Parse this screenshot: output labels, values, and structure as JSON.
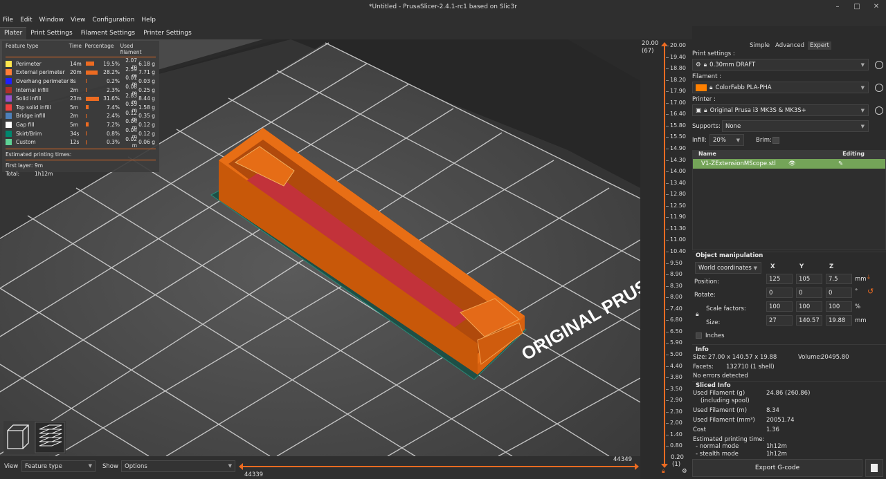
{
  "app": {
    "title": "*Untitled - PrusaSlicer-2.4.1-rc1 based on Slic3r"
  },
  "menu": [
    "File",
    "Edit",
    "Window",
    "View",
    "Configuration",
    "Help"
  ],
  "tabs": [
    "Plater",
    "Print Settings",
    "Filament Settings",
    "Printer Settings"
  ],
  "legend": {
    "headers": {
      "feature": "Feature type",
      "time": "Time",
      "pct": "Percentage",
      "filament": "Used filament"
    },
    "rows": [
      {
        "name": "Perimeter",
        "time": "14m",
        "pct": "19.5%",
        "m": "2.07 m",
        "g": "6.18 g",
        "color": "#ffe64d",
        "frac": 0.195
      },
      {
        "name": "External perimeter",
        "time": "20m",
        "pct": "28.2%",
        "m": "2.59 m",
        "g": "7.71 g",
        "color": "#ff7d38",
        "frac": 0.282
      },
      {
        "name": "Overhang perimeter",
        "time": "8s",
        "pct": "0.2%",
        "m": "0.01 m",
        "g": "0.03 g",
        "color": "#1f1fff",
        "frac": 0.002
      },
      {
        "name": "Internal infill",
        "time": "2m",
        "pct": "2.3%",
        "m": "0.08 m",
        "g": "0.25 g",
        "color": "#b03029",
        "frac": 0.023
      },
      {
        "name": "Solid infill",
        "time": "23m",
        "pct": "31.6%",
        "m": "2.83 m",
        "g": "8.44 g",
        "color": "#9654cc",
        "frac": 0.316
      },
      {
        "name": "Top solid infill",
        "time": "5m",
        "pct": "7.4%",
        "m": "0.53 m",
        "g": "1.58 g",
        "color": "#f04040",
        "frac": 0.074
      },
      {
        "name": "Bridge infill",
        "time": "2m",
        "pct": "2.4%",
        "m": "0.12 m",
        "g": "0.35 g",
        "color": "#4d80ba",
        "frac": 0.024
      },
      {
        "name": "Gap fill",
        "time": "5m",
        "pct": "7.2%",
        "m": "0.04 m",
        "g": "0.12 g",
        "color": "#ffffff",
        "frac": 0.072
      },
      {
        "name": "Skirt/Brim",
        "time": "34s",
        "pct": "0.8%",
        "m": "0.04 m",
        "g": "0.12 g",
        "color": "#00876e",
        "frac": 0.008
      },
      {
        "name": "Custom",
        "time": "12s",
        "pct": "0.3%",
        "m": "0.02 m",
        "g": "0.06 g",
        "color": "#5ed194",
        "frac": 0.003
      }
    ],
    "est_label": "Estimated printing times:",
    "first_layer_label": "First layer:",
    "first_layer": "9m",
    "total_label": "Total:",
    "total": "1h12m"
  },
  "bed_text": "ORIGINAL PRUSA",
  "bottom": {
    "view_label": "View",
    "view_value": "Feature type",
    "show_label": "Show",
    "show_value": "Options",
    "h_right": "44349",
    "h_left": "44339"
  },
  "vslider": {
    "top_value": "20.00",
    "top_layer": "(67)",
    "bottom_value": "0.20",
    "bottom_layer": "(1)",
    "ticks": [
      "20.00",
      "19.40",
      "18.80",
      "18.20",
      "17.90",
      "17.00",
      "16.40",
      "15.80",
      "15.50",
      "14.90",
      "14.30",
      "14.00",
      "13.40",
      "12.80",
      "12.50",
      "11.90",
      "11.30",
      "11.00",
      "10.40",
      "9.50",
      "8.90",
      "8.30",
      "8.00",
      "7.40",
      "6.80",
      "6.50",
      "5.90",
      "5.00",
      "4.40",
      "3.80",
      "3.50",
      "2.90",
      "2.30",
      "2.00",
      "1.40",
      "0.80",
      "0.20"
    ]
  },
  "panel": {
    "modes": [
      "Simple",
      "Advanced",
      "Expert"
    ],
    "print_settings_label": "Print settings :",
    "print_settings_value": "0.30mm DRAFT",
    "filament_label": "Filament :",
    "filament_value": "ColorFabb PLA-PHA",
    "filament_color": "#ff8000",
    "printer_label": "Printer :",
    "printer_value": "Original Prusa i3 MK3S & MK3S+",
    "supports_label": "Supports:",
    "supports_value": "None",
    "infill_label": "Infill:",
    "infill_value": "20%",
    "brim_label": "Brim:",
    "list_name_header": "Name",
    "list_editing_header": "Editing",
    "object_name": "V1-ZExtensionMScope.stl",
    "objman_title": "Object manipulation",
    "coord_system": "World coordinates",
    "axis_x": "X",
    "axis_y": "Y",
    "axis_z": "Z",
    "position_label": "Position:",
    "pos": [
      "125",
      "105",
      "7.5"
    ],
    "pos_unit": "mm",
    "rotate_label": "Rotate:",
    "rot": [
      "0",
      "0",
      "0"
    ],
    "rot_unit": "°",
    "scale_label": "Scale factors:",
    "scale": [
      "100",
      "100",
      "100"
    ],
    "scale_unit": "%",
    "size_label": "Size:",
    "size": [
      "27",
      "140.57",
      "19.88"
    ],
    "size_unit": "mm",
    "inches_label": "Inches",
    "info_title": "Info",
    "info_size_label": "Size:",
    "info_size": "27.00 x 140.57 x 19.88",
    "info_volume_label": "Volume:",
    "info_volume": "20495.80",
    "info_facets_label": "Facets:",
    "info_facets": "132710 (1 shell)",
    "info_errors": "No errors detected",
    "sliced_title": "Sliced Info",
    "used_g_label": "Used Filament (g)",
    "used_g_sub": "(including spool)",
    "used_g": "24.86 (260.86)",
    "used_m_label": "Used Filament (m)",
    "used_m": "8.34",
    "used_mm3_label": "Used Filament (mm³)",
    "used_mm3": "20051.74",
    "cost_label": "Cost",
    "cost": "1.36",
    "est_time_label": "Estimated printing time:",
    "normal_label": "- normal mode",
    "normal": "1h12m",
    "stealth_label": "- stealth mode",
    "stealth": "1h12m",
    "export_label": "Export G-code"
  }
}
